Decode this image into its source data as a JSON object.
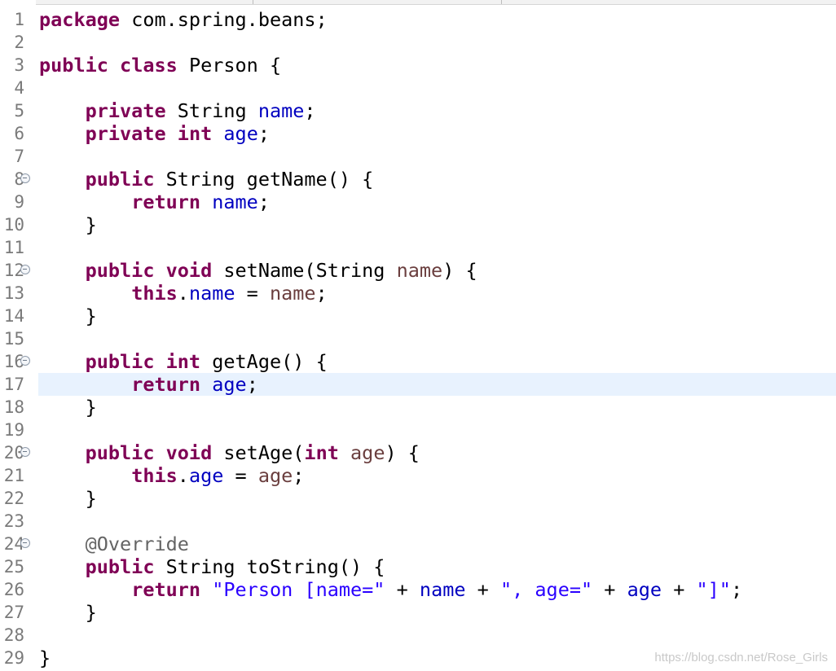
{
  "editor": {
    "lines": [
      {
        "n": "1",
        "fold": false,
        "tokens": [
          {
            "t": "package",
            "c": "kw"
          },
          {
            "t": " com.spring.beans;",
            "c": ""
          }
        ]
      },
      {
        "n": "2",
        "fold": false,
        "tokens": []
      },
      {
        "n": "3",
        "fold": false,
        "tokens": [
          {
            "t": "public",
            "c": "kw"
          },
          {
            "t": " ",
            "c": ""
          },
          {
            "t": "class",
            "c": "kw"
          },
          {
            "t": " Person {",
            "c": ""
          }
        ]
      },
      {
        "n": "4",
        "fold": false,
        "tokens": []
      },
      {
        "n": "5",
        "fold": false,
        "tokens": [
          {
            "t": "    ",
            "c": ""
          },
          {
            "t": "private",
            "c": "kw"
          },
          {
            "t": " String ",
            "c": ""
          },
          {
            "t": "name",
            "c": "fld"
          },
          {
            "t": ";",
            "c": ""
          }
        ]
      },
      {
        "n": "6",
        "fold": false,
        "tokens": [
          {
            "t": "    ",
            "c": ""
          },
          {
            "t": "private",
            "c": "kw"
          },
          {
            "t": " ",
            "c": ""
          },
          {
            "t": "int",
            "c": "kw"
          },
          {
            "t": " ",
            "c": ""
          },
          {
            "t": "age",
            "c": "fld"
          },
          {
            "t": ";",
            "c": ""
          }
        ]
      },
      {
        "n": "7",
        "fold": false,
        "tokens": []
      },
      {
        "n": "8",
        "fold": true,
        "tokens": [
          {
            "t": "    ",
            "c": ""
          },
          {
            "t": "public",
            "c": "kw"
          },
          {
            "t": " String getName() {",
            "c": ""
          }
        ]
      },
      {
        "n": "9",
        "fold": false,
        "tokens": [
          {
            "t": "        ",
            "c": ""
          },
          {
            "t": "return",
            "c": "kw"
          },
          {
            "t": " ",
            "c": ""
          },
          {
            "t": "name",
            "c": "fld"
          },
          {
            "t": ";",
            "c": ""
          }
        ]
      },
      {
        "n": "10",
        "fold": false,
        "tokens": [
          {
            "t": "    }",
            "c": ""
          }
        ]
      },
      {
        "n": "11",
        "fold": false,
        "tokens": []
      },
      {
        "n": "12",
        "fold": true,
        "tokens": [
          {
            "t": "    ",
            "c": ""
          },
          {
            "t": "public",
            "c": "kw"
          },
          {
            "t": " ",
            "c": ""
          },
          {
            "t": "void",
            "c": "kw"
          },
          {
            "t": " setName(String ",
            "c": ""
          },
          {
            "t": "name",
            "c": "par"
          },
          {
            "t": ") {",
            "c": ""
          }
        ]
      },
      {
        "n": "13",
        "fold": false,
        "tokens": [
          {
            "t": "        ",
            "c": ""
          },
          {
            "t": "this",
            "c": "kw"
          },
          {
            "t": ".",
            "c": ""
          },
          {
            "t": "name",
            "c": "fld"
          },
          {
            "t": " = ",
            "c": ""
          },
          {
            "t": "name",
            "c": "par"
          },
          {
            "t": ";",
            "c": ""
          }
        ]
      },
      {
        "n": "14",
        "fold": false,
        "tokens": [
          {
            "t": "    }",
            "c": ""
          }
        ]
      },
      {
        "n": "15",
        "fold": false,
        "tokens": []
      },
      {
        "n": "16",
        "fold": true,
        "tokens": [
          {
            "t": "    ",
            "c": ""
          },
          {
            "t": "public",
            "c": "kw"
          },
          {
            "t": " ",
            "c": ""
          },
          {
            "t": "int",
            "c": "kw"
          },
          {
            "t": " getAge() {",
            "c": ""
          }
        ]
      },
      {
        "n": "17",
        "fold": false,
        "current": true,
        "tokens": [
          {
            "t": "        ",
            "c": ""
          },
          {
            "t": "return",
            "c": "kw"
          },
          {
            "t": " ",
            "c": ""
          },
          {
            "t": "age",
            "c": "fld"
          },
          {
            "t": ";",
            "c": ""
          }
        ]
      },
      {
        "n": "18",
        "fold": false,
        "tokens": [
          {
            "t": "    }",
            "c": ""
          }
        ]
      },
      {
        "n": "19",
        "fold": false,
        "tokens": []
      },
      {
        "n": "20",
        "fold": true,
        "tokens": [
          {
            "t": "    ",
            "c": ""
          },
          {
            "t": "public",
            "c": "kw"
          },
          {
            "t": " ",
            "c": ""
          },
          {
            "t": "void",
            "c": "kw"
          },
          {
            "t": " setAge(",
            "c": ""
          },
          {
            "t": "int",
            "c": "kw"
          },
          {
            "t": " ",
            "c": ""
          },
          {
            "t": "age",
            "c": "par"
          },
          {
            "t": ") {",
            "c": ""
          }
        ]
      },
      {
        "n": "21",
        "fold": false,
        "tokens": [
          {
            "t": "        ",
            "c": ""
          },
          {
            "t": "this",
            "c": "kw"
          },
          {
            "t": ".",
            "c": ""
          },
          {
            "t": "age",
            "c": "fld"
          },
          {
            "t": " = ",
            "c": ""
          },
          {
            "t": "age",
            "c": "par"
          },
          {
            "t": ";",
            "c": ""
          }
        ]
      },
      {
        "n": "22",
        "fold": false,
        "tokens": [
          {
            "t": "    }",
            "c": ""
          }
        ]
      },
      {
        "n": "23",
        "fold": false,
        "tokens": []
      },
      {
        "n": "24",
        "fold": true,
        "tokens": [
          {
            "t": "    ",
            "c": ""
          },
          {
            "t": "@Override",
            "c": "ann"
          }
        ]
      },
      {
        "n": "25",
        "fold": false,
        "tokens": [
          {
            "t": "    ",
            "c": ""
          },
          {
            "t": "public",
            "c": "kw"
          },
          {
            "t": " String toString() {",
            "c": ""
          }
        ]
      },
      {
        "n": "26",
        "fold": false,
        "tokens": [
          {
            "t": "        ",
            "c": ""
          },
          {
            "t": "return",
            "c": "kw"
          },
          {
            "t": " ",
            "c": ""
          },
          {
            "t": "\"Person [name=\"",
            "c": "str"
          },
          {
            "t": " + ",
            "c": ""
          },
          {
            "t": "name",
            "c": "fld"
          },
          {
            "t": " + ",
            "c": ""
          },
          {
            "t": "\", age=\"",
            "c": "str"
          },
          {
            "t": " + ",
            "c": ""
          },
          {
            "t": "age",
            "c": "fld"
          },
          {
            "t": " + ",
            "c": ""
          },
          {
            "t": "\"]\"",
            "c": "str"
          },
          {
            "t": ";",
            "c": ""
          }
        ]
      },
      {
        "n": "27",
        "fold": false,
        "tokens": [
          {
            "t": "    }",
            "c": ""
          }
        ]
      },
      {
        "n": "28",
        "fold": false,
        "tokens": []
      },
      {
        "n": "29",
        "fold": false,
        "tokens": [
          {
            "t": "}",
            "c": ""
          }
        ]
      }
    ]
  },
  "watermark": "https://blog.csdn.net/Rose_Girls",
  "colors": {
    "keyword": "#7f0055",
    "field": "#0000c0",
    "parameter": "#6a3e3e",
    "string": "#2a00ff",
    "annotation": "#646464",
    "current_line": "#e8f2fe",
    "line_number": "#7a7a7a"
  },
  "icons": {
    "fold_marker": "collapse-minus-circle-icon"
  }
}
